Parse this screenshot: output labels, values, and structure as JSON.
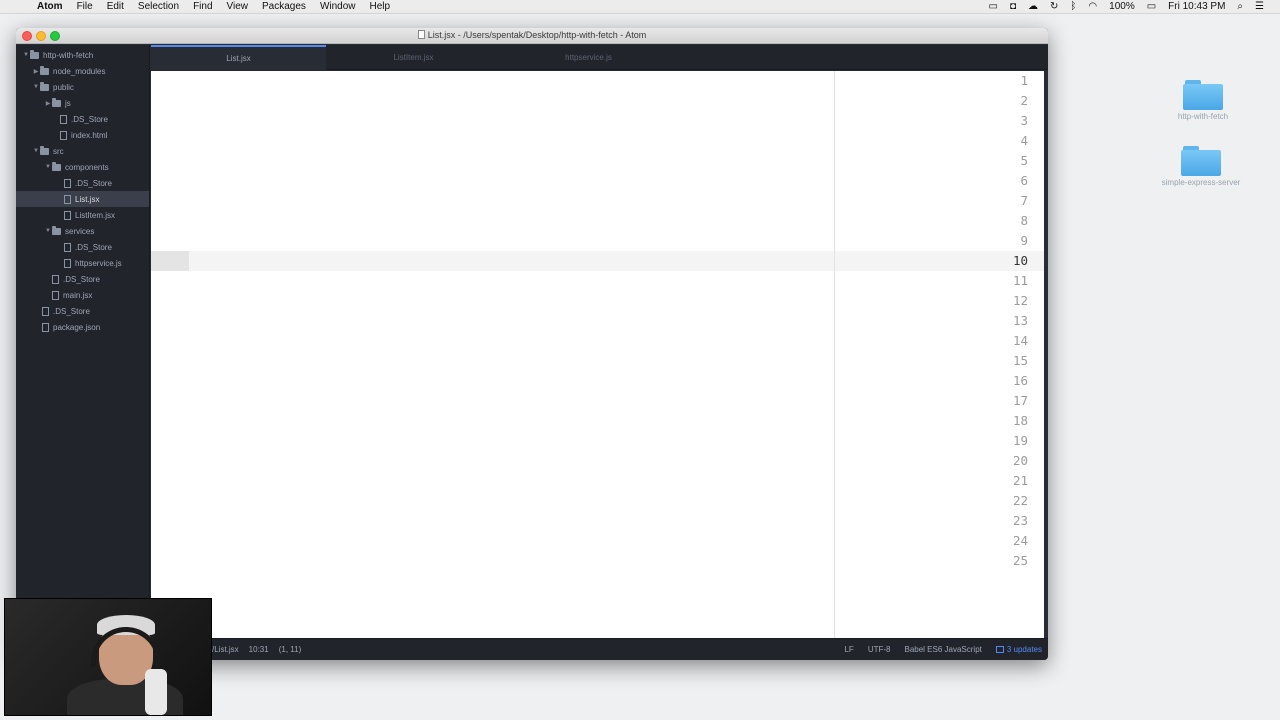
{
  "menubar": {
    "app": "Atom",
    "items": [
      "File",
      "Edit",
      "Selection",
      "Find",
      "View",
      "Packages",
      "Window",
      "Help"
    ],
    "battery": "100%",
    "clock": "Fri 10:43 PM"
  },
  "desktop": {
    "items": [
      {
        "label": "http-with-fetch"
      },
      {
        "label": "simple-express-server"
      }
    ]
  },
  "window": {
    "title": "List.jsx - /Users/spentak/Desktop/http-with-fetch - Atom"
  },
  "tree": {
    "root": "http-with-fetch",
    "items": [
      {
        "label": "node_modules",
        "type": "dir"
      },
      {
        "label": "public",
        "type": "dir"
      },
      {
        "label": "js",
        "type": "dir"
      },
      {
        "label": ".DS_Store",
        "type": "file"
      },
      {
        "label": "index.html",
        "type": "file"
      },
      {
        "label": "src",
        "type": "dir"
      },
      {
        "label": "components",
        "type": "dir"
      },
      {
        "label": ".DS_Store",
        "type": "file"
      },
      {
        "label": "List.jsx",
        "type": "file"
      },
      {
        "label": "ListItem.jsx",
        "type": "file"
      },
      {
        "label": "services",
        "type": "dir"
      },
      {
        "label": ".DS_Store",
        "type": "file"
      },
      {
        "label": "httpservice.js",
        "type": "file"
      },
      {
        "label": ".DS_Store",
        "type": "file"
      },
      {
        "label": "main.jsx",
        "type": "file"
      },
      {
        "label": ".DS_Store",
        "type": "file"
      },
      {
        "label": "package.json",
        "type": "file"
      }
    ]
  },
  "tabs": [
    {
      "label": "List.jsx"
    },
    {
      "label": "ListItem.jsx"
    },
    {
      "label": "httpservice.js"
    }
  ],
  "editor": {
    "line_numbers": [
      "1",
      "2",
      "3",
      "4",
      "5",
      "6",
      "7",
      "8",
      "9",
      "10",
      "11",
      "12",
      "13",
      "14",
      "15",
      "16",
      "17",
      "18",
      "19",
      "20",
      "21",
      "22",
      "23",
      "24",
      "25"
    ]
  },
  "status": {
    "path": "s/List.jsx",
    "cursor": "10:31",
    "selection": "(1, 11)",
    "line_ending": "LF",
    "encoding": "UTF-8",
    "grammar": "Babel ES6 JavaScript",
    "updates": "3 updates"
  }
}
